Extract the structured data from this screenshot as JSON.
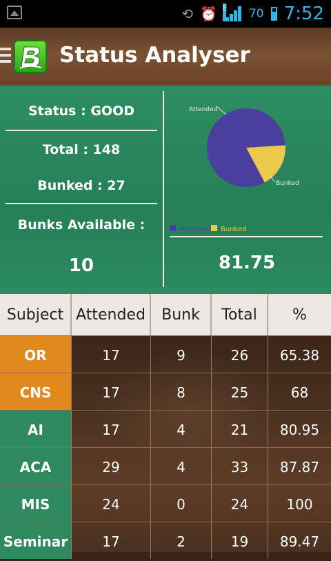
{
  "colors": {
    "accent": "#33b5e5",
    "panel_green": "#2b8a5f",
    "orange": "#e08a1e",
    "green_row": "#2e8a5e",
    "attended": "#4a3f9e",
    "bunked": "#ecc84b"
  },
  "statusbar": {
    "battery": "70",
    "time": "7:52",
    "network_label": "E"
  },
  "header": {
    "title": "Status Analyser"
  },
  "summary": {
    "status": "Status : GOOD",
    "total": "Total : 148",
    "bunked": "Bunked : 27",
    "bunks_available_label": "Bunks Available :",
    "bunks_available_value": "10",
    "percentage": "81.75"
  },
  "chart_data": {
    "type": "pie",
    "slices": [
      {
        "name": "Attended",
        "value": 121,
        "color": "#4a3f9e"
      },
      {
        "name": "Bunked",
        "value": 27,
        "color": "#ecc84b"
      }
    ],
    "legend": [
      "Attended",
      "Bunked"
    ],
    "legend_placement": "bottom-left"
  },
  "table": {
    "headers": [
      "Subject",
      "Attended",
      "Bunk",
      "Total",
      "%"
    ],
    "rows": [
      {
        "subject": "OR",
        "attended": "17",
        "bunk": "9",
        "total": "26",
        "percent": "65.38",
        "color": "#e08a1e"
      },
      {
        "subject": "CNS",
        "attended": "17",
        "bunk": "8",
        "total": "25",
        "percent": "68",
        "color": "#e08a1e"
      },
      {
        "subject": "AI",
        "attended": "17",
        "bunk": "4",
        "total": "21",
        "percent": "80.95",
        "color": "#2e8a5e"
      },
      {
        "subject": "ACA",
        "attended": "29",
        "bunk": "4",
        "total": "33",
        "percent": "87.87",
        "color": "#2e8a5e"
      },
      {
        "subject": "MIS",
        "attended": "24",
        "bunk": "0",
        "total": "24",
        "percent": "100",
        "color": "#2e8a5e"
      },
      {
        "subject": "Seminar",
        "attended": "17",
        "bunk": "2",
        "total": "19",
        "percent": "89.47",
        "color": "#2e8a5e"
      }
    ]
  }
}
